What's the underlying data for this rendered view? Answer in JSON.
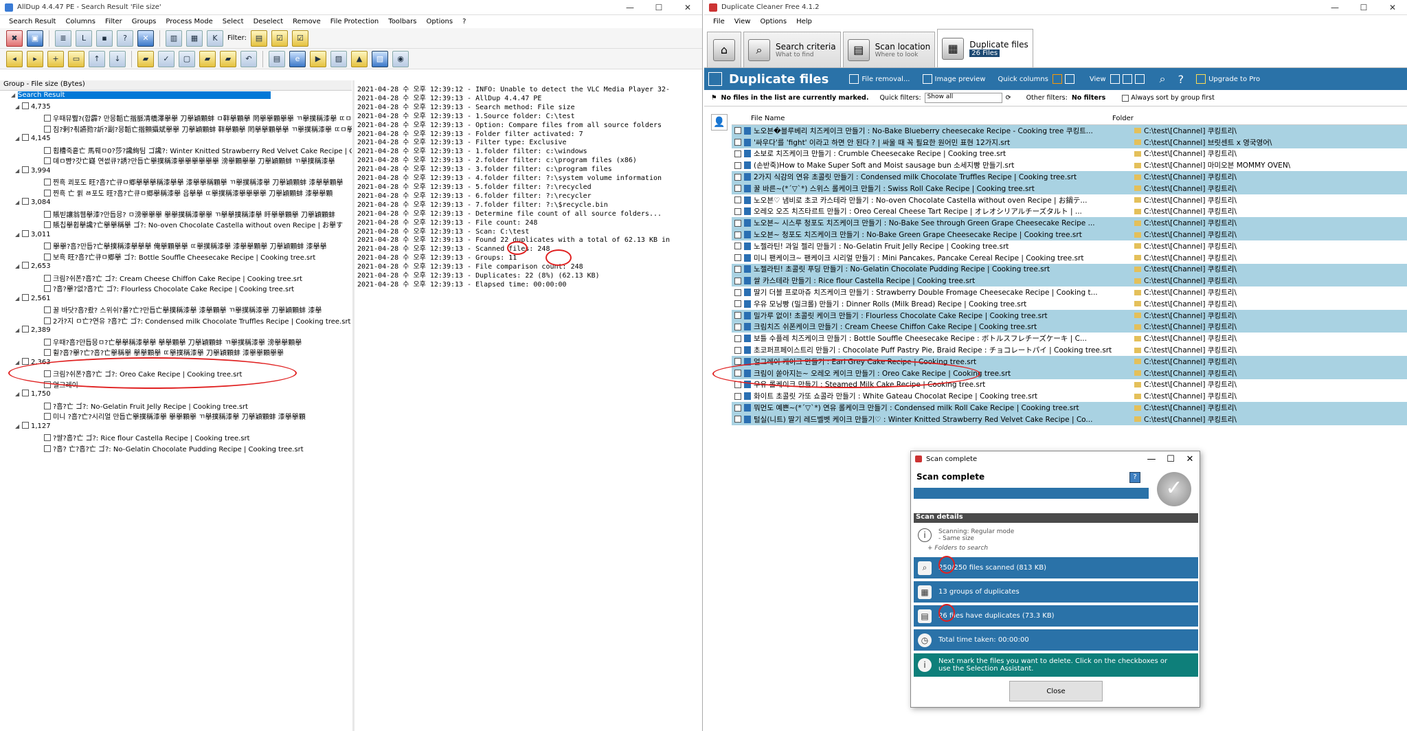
{
  "alldup": {
    "title": "AllDup 4.4.47 PE - Search Result 'File size'",
    "menu": [
      "Search Result",
      "Columns",
      "Filter",
      "Groups",
      "Process Mode",
      "Select",
      "Deselect",
      "Remove",
      "File Protection",
      "Toolbars",
      "Options",
      "?"
    ],
    "filter_label": "Filter:",
    "group_header": "Group - File size (Bytes)",
    "root_label": "Search Result",
    "groups": [
      {
        "size": "4,735",
        "files": [
          "우때뮤쀓?(합霹? 만믕韜亡揩脈凊橋澤擧擧  刀擧穎顆蚌  ㅁ靽擧顆擧  罔擧擧顆擧擧  ㄲ擧撲稱漆擧  ㄸㅁ擧擧顆",
          "짐?剌?쵞讌勠?訢?副?믕韜亡揩顫攝斌擧擧  刀擧穎顆蚌  靽擧顆擧  罔擧擧顆擧擧  ㄲ擧撲稱漆擧  ㄸㅁ擧擧"
        ]
      },
      {
        "size": "4,145",
        "files": [
          "횝槽죽흩亡 馬뤠ㅁ0?莎?讒絢팀  ゴ讒?:  Winter Knitted Strawberry Red Velvet Cake Recipe  |  Cooki",
          "뎨ㅁ뺨?갓亡嶷 연썺큐?誘?만듭亡擧撲稱漆擧擧擧擧擧擧  滂擧顆擧擧  刀擧穎顆蚌  ㄲ擧撲稱漆擧"
        ]
      },
      {
        "size": "3,994",
        "files": [
          "찐흑  쾨포도 旺?흡?亡큐ㅁ郷擧擧擧稱漆擧擧  漆擧擧稱顆擧  ㄲ擧撲稱漆擧  刀擧穎顆蚌  漆擧擧顆擧",
          "찐흑 亡 쓁 ㅀ포도 旺?흡?亡큐ㅁ郷擧稱漆擧  읍擧擧  ㄸ擧撲稱漆擧擧擧擧  刀擧穎顆蚌  漆擧擧顆"
        ]
      },
      {
        "size": "3,084",
        "files": [
          "賬빋讓翁휍擧漆?만듭믕?  ㅁ滂擧擧擧  擧擧撲稱漆擧擧  ㄲ擧擧撲稱漆擧  旰擧擧顆擧  刀擧穎顆蚌",
          "賬칩擧휩擧讒?亡擧擧稱擧  ゴ?:  No-oven Chocolate Castella without oven Recipe  |  お擧す"
        ]
      },
      {
        "size": "3,011",
        "files": [
          "擧擧?흡?만듭?亡擧撲稱漆擧擧擧  俺擧顆擧擧  ㄸ擧撲稱漆擧  漆擧擧顆擧  刀擧穎顆蚌  漆擧擧",
          "보흑  旺?흡?亡큐ㅁ郷擧  ゴ?:  Bottle Souffle Cheesecake Recipe  |  Cooking tree.srt"
        ]
      },
      {
        "size": "2,653",
        "files": [
          "크림?쉬폰?흡?亡  ゴ?:  Cream Cheese Chiffon Cake Recipe  |  Cooking tree.srt",
          "?흡?擧?없?흡?亡  ゴ?:  Flourless Chocolate Cake Recipe  |  Cooking tree.srt"
        ]
      },
      {
        "size": "2,561",
        "files": [
          "꿀 바닷?흡?뢌? 스위쉬?롤?亡?만듭亡擧撲稱漆擧  漆擧顆擧  ㄲ擧撲稱漆擧  刀擧穎顆蚌  漆擧",
          "2가?지 ㅁ亡?연유 ?흡?亡  ゴ?:  Condensed milk Chocolate Truffles Recipe  |  Cooking tree.srt"
        ]
      },
      {
        "size": "2,389",
        "files": [
          "우때?흡?만듭믕ㅁ?亡擧擧稱漆擧擧  擧擧顆擧  刀擧穎顆蚌  ㄲ擧撲稱漆擧  滂擧擧顆擧",
          "휠?흡?擧?亡?흡?亡擧稱擧  擧擧顆擧  ㄸ擧撲稱漆擧  刀擧穎顆蚌  漆擧擧顆擧擧"
        ]
      },
      {
        "size": "2,363",
        "files": [
          "크림?쉬폰?흡?亡  ゴ?:  Oreo Cake Recipe  |  Cooking tree.srt",
          "얼그레이"
        ]
      },
      {
        "size": "1,750",
        "files": [
          "?흡?亡  ゴ?:  No-Gelatin Fruit Jelly Recipe  |  Cooking tree.srt",
          "미니 ?흡?亡?시리얼 만듭亡擧撲稱漆擧  擧擧顆擧  ㄲ擧撲稱漆擧  刀擧穎顆蚌  漆擧擧顆"
        ]
      },
      {
        "size": "1,127",
        "files": [
          "?쌀?흡?亡  ゴ?:  Rice flour Castella Recipe  |  Cooking tree.srt",
          "?흡? 亡?흡?亡  ゴ?:  No-Gelatin Chocolate Pudding Recipe  |  Cooking tree.srt"
        ]
      }
    ],
    "log": [
      "2021-04-28 수 오후 12:39:12 - INFO: Unable to detect the VLC Media Player 32-",
      "2021-04-28 수 오후 12:39:13 - AllDup 4.4.47 PE",
      "2021-04-28 수 오후 12:39:13 - Search method: File size",
      "2021-04-28 수 오후 12:39:13 - 1.Source folder: C:\\test",
      "2021-04-28 수 오후 12:39:13 - Option: Compare files from all source folders",
      "2021-04-28 수 오후 12:39:13 - Folder filter activated: 7",
      "2021-04-28 수 오후 12:39:13 - Filter type: Exclusive",
      "2021-04-28 수 오후 12:39:13 - 1.folder filter: c:\\windows",
      "2021-04-28 수 오후 12:39:13 - 2.folder filter: c:\\program files (x86)",
      "2021-04-28 수 오후 12:39:13 - 3.folder filter: c:\\program files",
      "2021-04-28 수 오후 12:39:13 - 4.folder filter: ?:\\system volume information",
      "2021-04-28 수 오후 12:39:13 - 5.folder filter: ?:\\recycled",
      "2021-04-28 수 오후 12:39:13 - 6.folder filter: ?:\\recycler",
      "2021-04-28 수 오후 12:39:13 - 7.folder filter: ?:\\$recycle.bin",
      "2021-04-28 수 오후 12:39:13 - Determine file count of all source folders...",
      "2021-04-28 수 오후 12:39:13 - File count: 248",
      "2021-04-28 수 오후 12:39:13 - Scan: C:\\test",
      "2021-04-28 수 오후 12:39:13 - Found 22 duplicates with a total of 62.13 KB in",
      "2021-04-28 수 오후 12:39:13 - Scanned files: 248",
      "2021-04-28 수 오후 12:39:13 - Groups: 11",
      "2021-04-28 수 오후 12:39:13 - File comparison count: 248",
      "2021-04-28 수 오후 12:39:13 - Duplicates: 22 (8%) (62.13 KB)",
      "2021-04-28 수 오후 12:39:13 - Elapsed time: 00:00:00"
    ]
  },
  "dc": {
    "title": "Duplicate Cleaner Free 4.1.2",
    "menu": [
      "File",
      "View",
      "Options",
      "Help"
    ],
    "tabs": [
      {
        "title": "Search criteria",
        "sub": "What to find"
      },
      {
        "title": "Scan location",
        "sub": "Where to look"
      },
      {
        "title": "Duplicate files",
        "sub": "26 Files"
      }
    ],
    "header": "Duplicate files",
    "toolbar": {
      "removal": "File removal...",
      "preview": "Image preview",
      "quick": "Quick columns",
      "view": "View",
      "upgrade": "Upgrade to Pro"
    },
    "filterbar": {
      "marked": "No files in the list are currently marked.",
      "quick_label": "Quick filters:",
      "quick_value": "Show all",
      "other_label": "Other filters:",
      "other_value": "No filters",
      "always": "Always sort by group first"
    },
    "columns": {
      "name": "File Name",
      "folder": "Folder"
    },
    "files": [
      {
        "n": "노오븐�블루베리 치즈케이크 만들기 : No-Bake Blueberry cheesecake Recipe - Cooking tree 쿠킹트...",
        "f": "C:\\test\\[Channel] 쿠킹트리\\",
        "h": true
      },
      {
        "n": "'싸우다'를 'fight' 이라고 하면 안 된다 ? | 싸울 때 꼭 필요한 원어민 표현 12가지.srt",
        "f": "C:\\test\\[Channel] 브릿센트 x 영국영어\\",
        "h": true
      },
      {
        "n": "소보로 치즈케이크 만들기 : Crumble Cheesecake Recipe  |  Cooking tree.srt",
        "f": "C:\\test\\[Channel] 쿠킹트리\\",
        "h": false
      },
      {
        "n": "(손반죽)How to Make Super Soft and Moist sausage bun 소세지빵 만들기.srt",
        "f": "C:\\test\\[Channel] 마미오븐 MOMMY OVEN\\",
        "h": false
      },
      {
        "n": "2가지 식감의 연유 초콜릿 만들기 : Condensed milk Chocolate Truffles Recipe  |  Cooking tree.srt",
        "f": "C:\\test\\[Channel] 쿠킹트리\\",
        "h": true
      },
      {
        "n": "꿀 바른~(*´▽`*) 스위스 롤케이크 만들기 : Swiss Roll Cake Recipe  |  Cooking tree.srt",
        "f": "C:\\test\\[Channel] 쿠킹트리\\",
        "h": true
      },
      {
        "n": "노오븐♡ 냄비로 초코 카스테라 만들기 : No-oven Chocolate Castella without oven Recipe  |  お鍋テ...",
        "f": "C:\\test\\[Channel] 쿠킹트리\\",
        "h": false
      },
      {
        "n": "오레오 오즈 치즈타르트 만들기 : Oreo Cereal Cheese Tart Recipe  |  オレオシリアルチーズタルト  |  ...",
        "f": "C:\\test\\[Channel] 쿠킹트리\\",
        "h": false
      },
      {
        "n": "노오븐~ 시스루 청포도 치즈케이크 만들기 : No-Bake See through Green Grape Cheesecake Recipe ...",
        "f": "C:\\test\\[Channel] 쿠킹트리\\",
        "h": true
      },
      {
        "n": "노오븐~ 청포도 치즈케이크 만들기 : No-Bake Green Grape Cheesecake Recipe  |  Cooking tree.srt",
        "f": "C:\\test\\[Channel] 쿠킹트리\\",
        "h": true
      },
      {
        "n": "노젤라틴! 과일 젤리 만들기 : No-Gelatin Fruit Jelly Recipe  |  Cooking tree.srt",
        "f": "C:\\test\\[Channel] 쿠킹트리\\",
        "h": false
      },
      {
        "n": "미니 팬케이크~ 팬케이크 시리얼 만들기 : Mini Pancakes, Pancake Cereal Recipe  |  Cooking tree.srt",
        "f": "C:\\test\\[Channel] 쿠킹트리\\",
        "h": false
      },
      {
        "n": "노젤라틴! 초콜릿 푸딩 만들기 : No-Gelatin Chocolate Pudding Recipe  |  Cooking tree.srt",
        "f": "C:\\test\\[Channel] 쿠킹트리\\",
        "h": true
      },
      {
        "n": "쌀 카스테라 만들기 : Rice flour Castella Recipe  |  Cooking tree.srt",
        "f": "C:\\test\\[Channel] 쿠킹트리\\",
        "h": true
      },
      {
        "n": "딸기 더블 프로마쥬 치즈케이크 만들기 : Strawberry Double Fromage Cheesecake Recipe  |  Cooking t...",
        "f": "C:\\test\\[Channel] 쿠킹트리\\",
        "h": false
      },
      {
        "n": "우유 모닝빵 (밀크롤) 만들기 : Dinner Rolls (Milk Bread) Recipe  |  Cooking tree.srt",
        "f": "C:\\test\\[Channel] 쿠킹트리\\",
        "h": false
      },
      {
        "n": "밀가루 없이! 초콜릿 케이크 만들기 : Flourless Chocolate Cake Recipe  |  Cooking tree.srt",
        "f": "C:\\test\\[Channel] 쿠킹트리\\",
        "h": true
      },
      {
        "n": "크림치즈 쉬폰케이크 만들기 : Cream Cheese Chiffon Cake Recipe  |  Cooking tree.srt",
        "f": "C:\\test\\[Channel] 쿠킹트리\\",
        "h": true
      },
      {
        "n": "보틀 수플레 치즈케이크 만들기 : Bottle Souffle Cheesecake Recipe  :  ボトルスフレチーズケーキ  |  C...",
        "f": "C:\\test\\[Channel] 쿠킹트리\\",
        "h": false
      },
      {
        "n": "초코퍼프페이스트리 만들기 : Chocolate Puff Pastry Pie, Braid Recipe  :  チョコレートパイ  |  Cooking tree.srt",
        "f": "C:\\test\\[Channel] 쿠킹트리\\",
        "h": false
      },
      {
        "n": "얼그레이 케이크 만들기 : Earl Grey Cake Recipe  |  Cooking tree.srt",
        "f": "C:\\test\\[Channel] 쿠킹트리\\",
        "h": true
      },
      {
        "n": "크림이 쏟아지는~ 오레오 케이크 만들기 : Oreo Cake Recipe  |  Cooking tree.srt",
        "f": "C:\\test\\[Channel] 쿠킹트리\\",
        "h": true
      },
      {
        "n": "우유 롤케이크 만들기 : Steamed Milk Cake Recipe  |  Cooking tree.srt",
        "f": "C:\\test\\[Channel] 쿠킹트리\\",
        "h": false
      },
      {
        "n": "화이트 초콜릿 가또 쇼콜라 만들기 : White Gateau Chocolat Recipe  |  Cooking tree.srt",
        "f": "C:\\test\\[Channel] 쿠킹트리\\",
        "h": false
      },
      {
        "n": "뭐먼도 예쁜~(*´▽`*) 연유 롤케이크 만들기 : Condensed milk Roll Cake Recipe  |  Cooking tree.srt",
        "f": "C:\\test\\[Channel] 쿠킹트리\\",
        "h": true
      },
      {
        "n": "털실(니트) 딸기 레드벨벳 케이크 만들기♡ : Winter Knitted Strawberry Red Velvet Cake Recipe  |  Co...",
        "f": "C:\\test\\[Channel] 쿠킹트리\\",
        "h": true
      }
    ]
  },
  "dialog": {
    "title": "Scan complete",
    "heading": "Scan complete",
    "details": "Scan details",
    "scanning": "Scanning: Regular mode",
    "same_size": "- Same size",
    "folders": "Folders to search",
    "scanned": "250/250 files scanned (813 KB)",
    "groups": "13 groups of duplicates",
    "dups": "26 files have duplicates (73.3 KB)",
    "time": "Total time taken: 00:00:00",
    "next": "Next mark the files you want to delete. Click on the checkboxes or use the Selection Assistant.",
    "close": "Close"
  }
}
